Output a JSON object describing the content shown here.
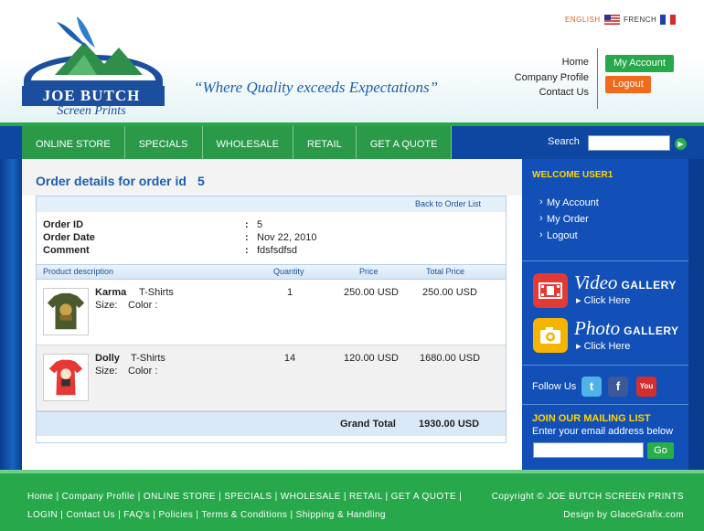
{
  "header": {
    "logo_text": "JOE BUTCH",
    "logo_sub": "Screen Prints",
    "tagline": "“Where Quality exceeds Expectations”",
    "lang_english": "ENGLISH",
    "lang_french": "FRENCH",
    "links": [
      "Home",
      "Company Profile",
      "Contact Us"
    ],
    "my_account": "My Account",
    "logout": "Logout"
  },
  "nav": {
    "items": [
      "ONLINE STORE",
      "SPECIALS",
      "WHOLESALE",
      "RETAIL",
      "GET A QUOTE"
    ],
    "search_label": "Search"
  },
  "order": {
    "title": "Order details for order id",
    "id": "5",
    "back_link": "Back to Order List",
    "info": [
      {
        "label": "Order ID",
        "value": "5"
      },
      {
        "label": "Order Date",
        "value": "Nov 22, 2010"
      },
      {
        "label": "Comment",
        "value": "fdsfsdfsd"
      }
    ],
    "headers": {
      "product": "Product description",
      "quantity": "Quantity",
      "price": "Price",
      "total": "Total Price"
    },
    "items": [
      {
        "name": "Karma",
        "category": "T-Shirts",
        "size": "Size:",
        "color": "Color :",
        "quantity": "1",
        "price": "250.00 USD",
        "total": "250.00 USD"
      },
      {
        "name": "Dolly",
        "category": "T-Shirts",
        "size": "Size:",
        "color": "Color :",
        "quantity": "14",
        "price": "120.00 USD",
        "total": "1680.00 USD"
      }
    ],
    "grand_total_label": "Grand Total",
    "grand_total": "1930.00 USD"
  },
  "sidebar": {
    "welcome": "WELCOME USER1",
    "links": [
      "My Account",
      "My Order",
      "Logout"
    ],
    "video_big": "Video",
    "video_small": "GALLERY",
    "photo_big": "Photo",
    "photo_small": "GALLERY",
    "click_here": "▸ Click Here",
    "follow": "Follow Us",
    "mail_title": "JOIN OUR MAILING LIST",
    "mail_sub": "Enter your email address below",
    "go": "Go"
  },
  "footer": {
    "line1": "Home | Company Profile | ONLINE STORE | SPECIALS | WHOLESALE | RETAIL | GET A QUOTE |",
    "line2": "LOGIN | Contact Us | FAQ's | Policies | Terms & Conditions | Shipping & Handling",
    "copyright": "Copyright © JOE BUTCH SCREEN PRINTS",
    "design": "Design by GlaceGrafix.com"
  },
  "colors": {
    "green": "#27a84a",
    "blue": "#0d47a1",
    "orange": "#f26b1d",
    "yellow": "#ffd400"
  }
}
